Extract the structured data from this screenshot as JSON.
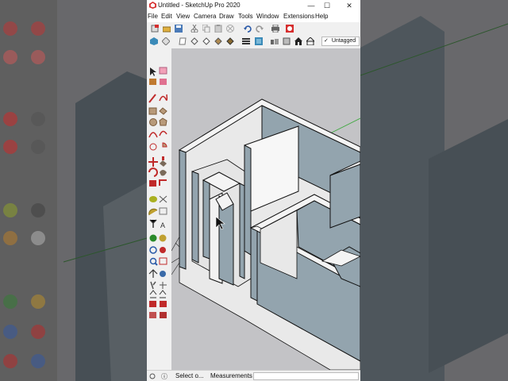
{
  "window": {
    "title": "Untitled - SketchUp Pro 2020",
    "controls": [
      "—",
      "☐",
      "✕"
    ]
  },
  "menu": {
    "items": [
      "File",
      "Edit",
      "View",
      "Camera",
      "Draw",
      "Tools",
      "Window",
      "Extensions",
      "Help"
    ]
  },
  "toolbar": {
    "tag_label": "Untagged",
    "tag_check": "✓"
  },
  "status": {
    "info_icon": "ⓘ",
    "prompt": "Select o...",
    "measurements_label": "Measurements"
  },
  "colors": {
    "canvas": "#c3c3c6",
    "wall_face": "#93a4ae",
    "wall_top": "#f4f4f4",
    "floor": "#e9e9e9",
    "axis_green": "#3aa83a",
    "axis_red": "#cc2a2a"
  },
  "tools": {
    "left_toolbar_icons": [
      "select-icon",
      "eraser-icon",
      "paint-bucket-icon",
      "line-icon",
      "freehand-icon",
      "rectangle-icon",
      "rotated-rectangle-icon",
      "circle-icon",
      "polygon-icon",
      "arc-icon",
      "pie-icon",
      "move-icon",
      "push-pull-icon",
      "rotate-icon",
      "follow-me-icon",
      "scale-icon",
      "offset-icon",
      "tape-measure-icon",
      "dimension-icon",
      "protractor-icon",
      "text-icon",
      "axes-icon",
      "3d-text-icon",
      "orbit-icon",
      "pan-icon",
      "zoom-icon",
      "zoom-window-icon",
      "zoom-extents-icon",
      "position-camera-icon",
      "walk-icon",
      "look-around-icon",
      "section-plane-icon",
      "warehouse-icon",
      "extension-warehouse-icon"
    ]
  }
}
